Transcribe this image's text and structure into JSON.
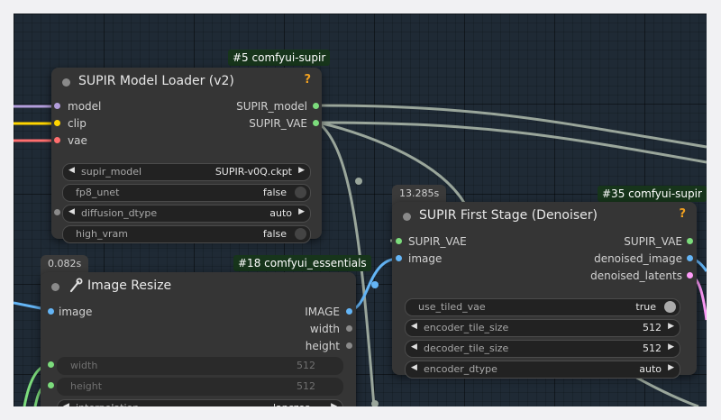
{
  "nodes": {
    "loader": {
      "badge": "#5 comfyui-supir",
      "title": "SUPIR Model Loader (v2)",
      "help": "?",
      "inputs": [
        "model",
        "clip",
        "vae"
      ],
      "outputs": [
        "SUPIR_model",
        "SUPIR_VAE"
      ],
      "widgets": [
        {
          "label": "supir_model",
          "value": "SUPIR-v0Q.ckpt"
        },
        {
          "label": "fp8_unet",
          "value": "false"
        },
        {
          "label": "diffusion_dtype",
          "value": "auto"
        },
        {
          "label": "high_vram",
          "value": "false"
        }
      ]
    },
    "denoiser": {
      "timing": "13.285s",
      "badge": "#35 comfyui-supir",
      "title": "SUPIR First Stage (Denoiser)",
      "help": "?",
      "inputs": [
        "SUPIR_VAE",
        "image"
      ],
      "outputs": [
        "SUPIR_VAE",
        "denoised_image",
        "denoised_latents"
      ],
      "widgets": [
        {
          "label": "use_tiled_vae",
          "value": "true"
        },
        {
          "label": "encoder_tile_size",
          "value": "512"
        },
        {
          "label": "decoder_tile_size",
          "value": "512"
        },
        {
          "label": "encoder_dtype",
          "value": "auto"
        }
      ]
    },
    "resize": {
      "timing": "0.082s",
      "badge": "#18 comfyui_essentials",
      "title": "Image Resize",
      "inputs": [
        "image"
      ],
      "outputs": [
        "IMAGE",
        "width",
        "height"
      ],
      "widgets": [
        {
          "label": "width",
          "value": "512"
        },
        {
          "label": "height",
          "value": "512"
        },
        {
          "label": "interpolation",
          "value": "lanczos"
        }
      ]
    }
  },
  "colors": {
    "model": "#b39ddb",
    "clip": "#ffd500",
    "vae": "#ff6e6e",
    "image": "#64b5f6",
    "supir": "#7cdc7c",
    "latent": "#ff9cf9",
    "int": "#7cdc7c",
    "wire_gray": "#9aa69b",
    "badge_bg": "#17351b"
  },
  "icons": {
    "resize": "wrench-icon",
    "help": "help-icon"
  }
}
